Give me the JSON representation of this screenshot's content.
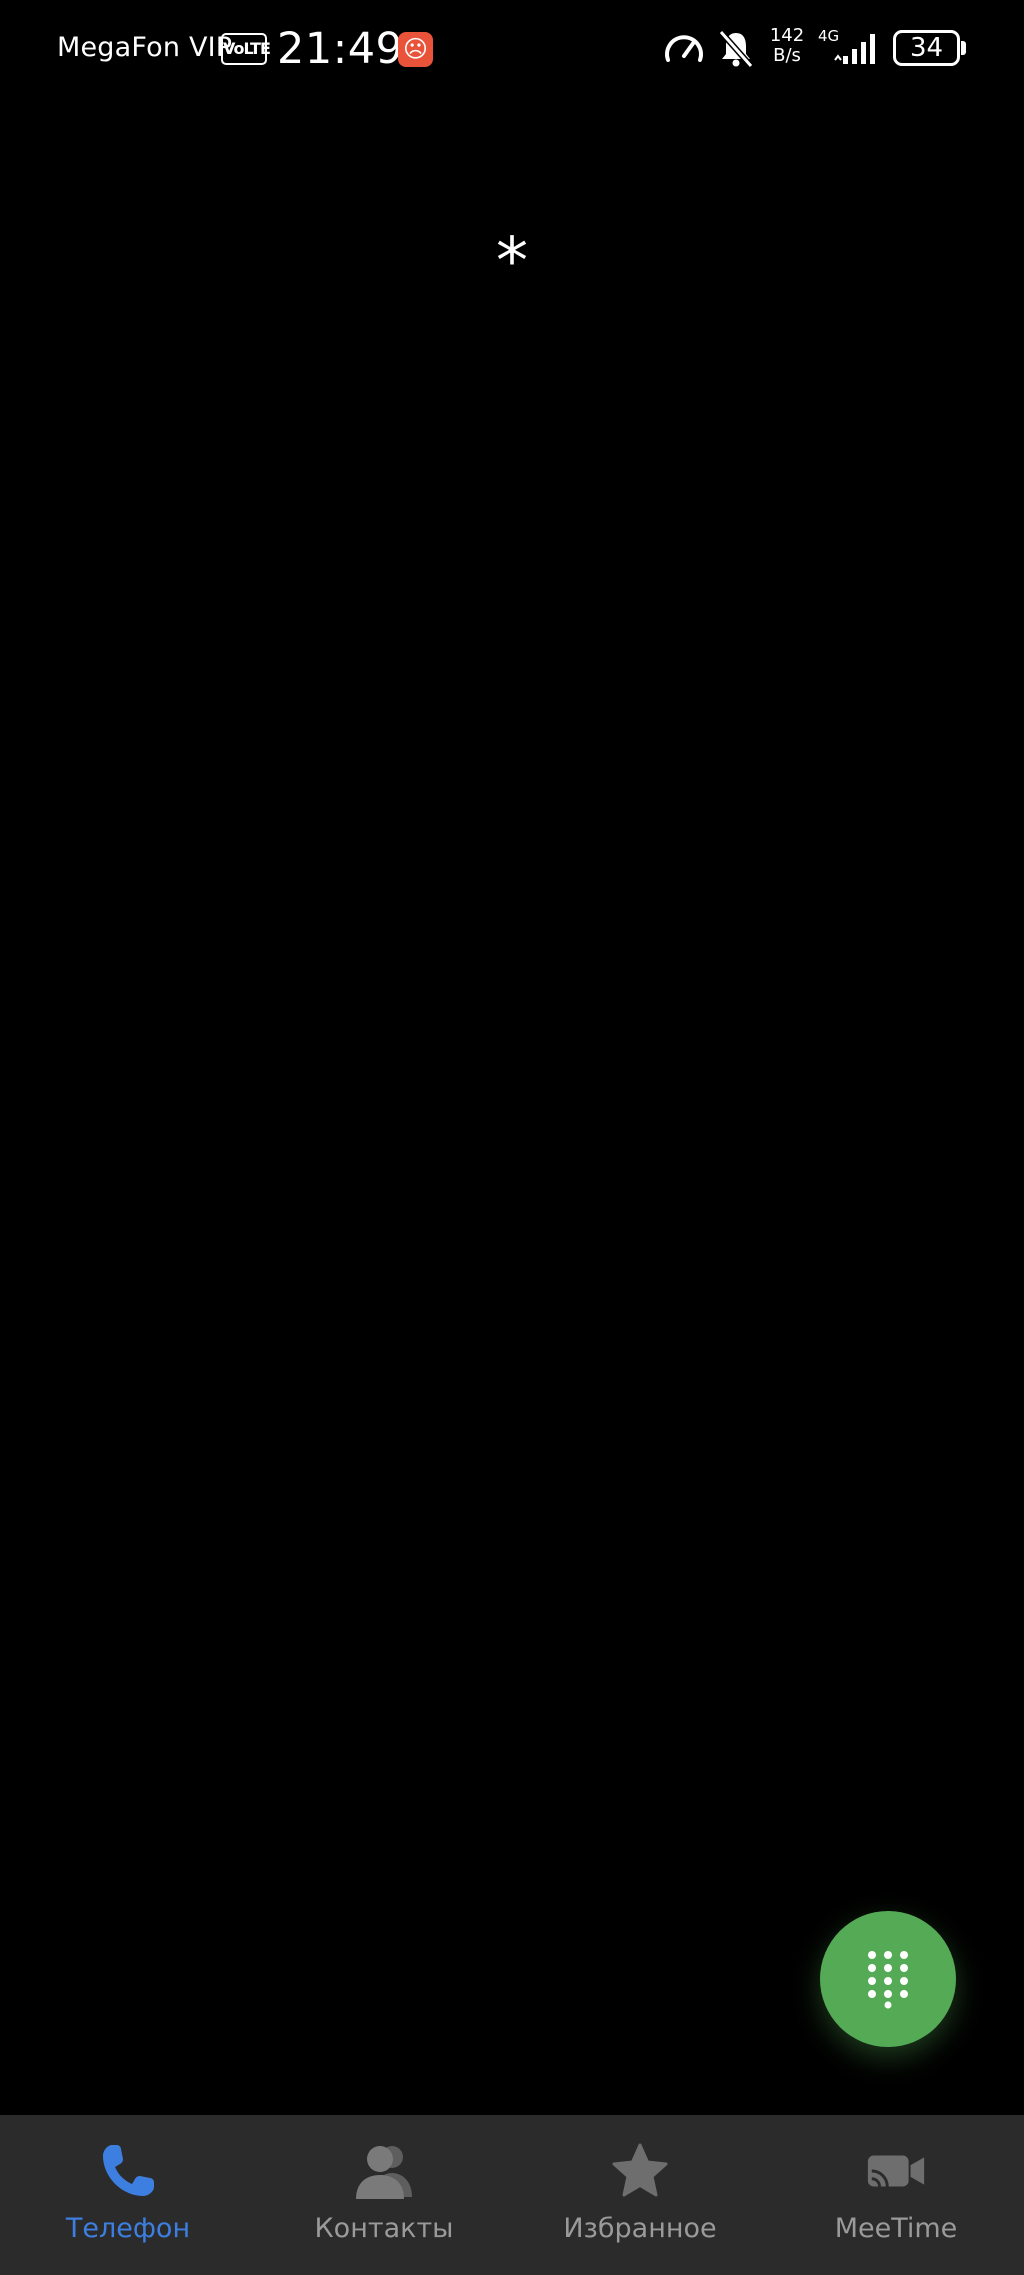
{
  "status_bar": {
    "carrier": "MegaFon VIP",
    "volte": "VoLTE",
    "time": "21:49",
    "net_speed_value": "142",
    "net_speed_unit": "B/s",
    "net_type": "4G",
    "battery": "34"
  },
  "dialer": {
    "input": "*"
  },
  "fab": {
    "icon": "dialpad-icon",
    "color": "#55aa55"
  },
  "bottom_nav": {
    "items": [
      {
        "label": "Телефон",
        "icon": "phone-icon",
        "active": true
      },
      {
        "label": "Контакты",
        "icon": "contacts-icon",
        "active": false
      },
      {
        "label": "Избранное",
        "icon": "star-icon",
        "active": false
      },
      {
        "label": "MeeTime",
        "icon": "video-call-icon",
        "active": false
      }
    ],
    "active_color": "#3d7fe0",
    "inactive_color": "#9a9a9a"
  }
}
